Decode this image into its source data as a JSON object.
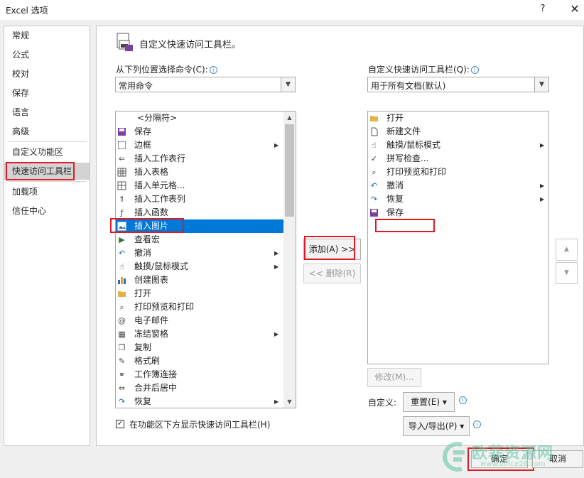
{
  "window": {
    "title": "Excel 选项",
    "help": "?",
    "close": "✕"
  },
  "sidebar": {
    "items": [
      "常规",
      "公式",
      "校对",
      "保存",
      "语言",
      "高级",
      "自定义功能区",
      "快速访问工具栏",
      "加载项",
      "信任中心"
    ],
    "selected_index": 7
  },
  "header": {
    "title": "自定义快速访问工具栏。"
  },
  "left": {
    "label": "从下列位置选择命令(C):",
    "combo_value": "常用命令",
    "items": [
      {
        "label": "<分隔符>",
        "icon": "separator"
      },
      {
        "label": "保存",
        "icon": "save-icon"
      },
      {
        "label": "边框",
        "icon": "border-icon",
        "submenu": true
      },
      {
        "label": "插入工作表行",
        "icon": "insert-row-icon"
      },
      {
        "label": "插入表格",
        "icon": "table-icon"
      },
      {
        "label": "插入单元格...",
        "icon": "insert-cell-icon"
      },
      {
        "label": "插入工作表列",
        "icon": "insert-column-icon"
      },
      {
        "label": "插入函数",
        "icon": "function-icon"
      },
      {
        "label": "插入图片",
        "icon": "picture-icon",
        "selected": true
      },
      {
        "label": "查看宏",
        "icon": "macro-icon"
      },
      {
        "label": "撤消",
        "icon": "undo-icon",
        "submenu": true
      },
      {
        "label": "触摸/鼠标模式",
        "icon": "touch-icon",
        "submenu": true
      },
      {
        "label": "创建图表",
        "icon": "chart-icon"
      },
      {
        "label": "打开",
        "icon": "folder-icon"
      },
      {
        "label": "打印预览和打印",
        "icon": "print-preview-icon"
      },
      {
        "label": "电子邮件",
        "icon": "email-icon"
      },
      {
        "label": "冻结窗格",
        "icon": "freeze-icon",
        "submenu": true
      },
      {
        "label": "复制",
        "icon": "copy-icon"
      },
      {
        "label": "格式刷",
        "icon": "format-painter-icon"
      },
      {
        "label": "工作簿连接",
        "icon": "connection-icon"
      },
      {
        "label": "合并后居中",
        "icon": "merge-icon"
      },
      {
        "label": "恢复",
        "icon": "redo-icon",
        "submenu": true
      }
    ],
    "checkbox_label": "在功能区下方显示快速访问工具栏(H)",
    "checkbox_checked": true
  },
  "middle": {
    "add_label": "添加(A) >>",
    "remove_label": "<< 删除(R)"
  },
  "right": {
    "label": "自定义快速访问工具栏(Q):",
    "combo_value": "用于所有文档(默认)",
    "items": [
      {
        "label": "打开",
        "icon": "folder-icon"
      },
      {
        "label": "新建文件",
        "icon": "new-file-icon"
      },
      {
        "label": "触摸/鼠标模式",
        "icon": "touch-icon",
        "submenu": true
      },
      {
        "label": "拼写检查...",
        "icon": "spellcheck-icon"
      },
      {
        "label": "打印预览和打印",
        "icon": "print-preview-icon"
      },
      {
        "label": "撤消",
        "icon": "undo-icon",
        "submenu": true
      },
      {
        "label": "恢复",
        "icon": "redo-icon",
        "submenu": true
      },
      {
        "label": "保存",
        "icon": "save-icon"
      }
    ],
    "modify_label": "修改(M)...",
    "custom_label": "自定义:",
    "reset_label": "重置(E) ▾",
    "import_export_label": "导入/导出(P) ▾"
  },
  "footer": {
    "ok_label": "确定",
    "cancel_label": "取消"
  },
  "watermark": {
    "text": "欧菲资源网",
    "url": "www.office26.com"
  },
  "colors": {
    "selection": "#0078d7",
    "highlight_box": "#e01b24",
    "sidebar_selected": "#d3d3d3"
  }
}
